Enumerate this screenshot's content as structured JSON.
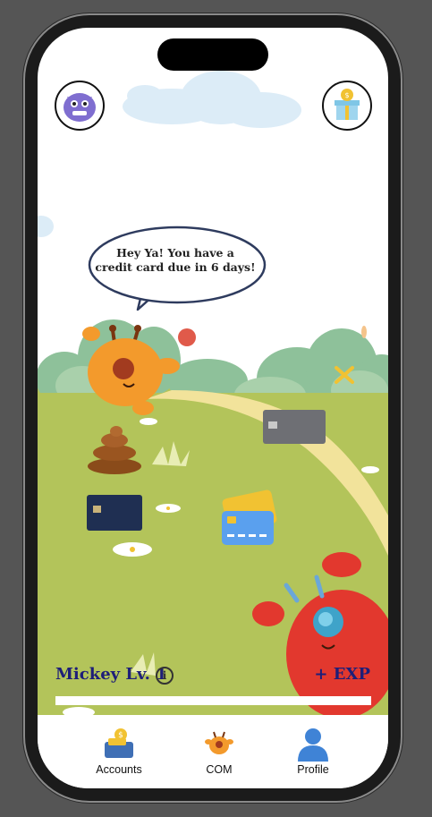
{
  "speech_bubble": {
    "line1": "Hey Ya! You have a",
    "line2": "credit card due in 6 days!"
  },
  "player": {
    "name_level": "Mickey Lv. 1",
    "info_symbol": "i",
    "exp_label": "+ EXP",
    "exp_progress": 0
  },
  "icons": {
    "profile_avatar": "purple-monster-icon",
    "gift": "gift-box-icon"
  },
  "tabs": [
    {
      "label": "Accounts",
      "icon": "accounts-icon"
    },
    {
      "label": "COM",
      "icon": "com-monster-icon"
    },
    {
      "label": "Profile",
      "icon": "profile-person-icon"
    }
  ],
  "colors": {
    "grass": "#b3c45a",
    "path": "#f2e39b",
    "trees": "#8ec19a",
    "level_text": "#1e1e78",
    "orange_monster": "#f39a2c",
    "red_monster": "#e2382e"
  }
}
